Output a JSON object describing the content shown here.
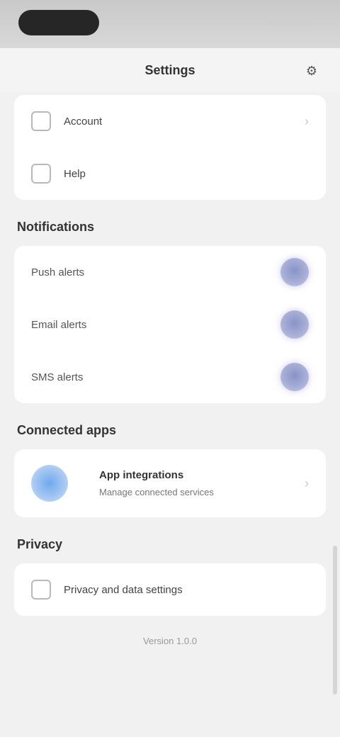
{
  "header": {
    "title": "Settings",
    "action_icon": "settings-icon"
  },
  "account": {
    "items": [
      {
        "label": "Account",
        "icon": "account-icon"
      },
      {
        "label": "Help",
        "icon": "help-icon"
      }
    ]
  },
  "notifications": {
    "title": "Notifications",
    "items": [
      {
        "label": "Push alerts",
        "icon": "toggle-on"
      },
      {
        "label": "Email alerts",
        "icon": "toggle-on"
      },
      {
        "label": "SMS alerts",
        "icon": "toggle-on"
      }
    ]
  },
  "apps": {
    "title": "Connected apps",
    "items": [
      {
        "name": "App integrations",
        "desc": "Manage connected services",
        "logo": "app-logo"
      }
    ]
  },
  "privacy": {
    "title": "Privacy",
    "items": [
      {
        "label": "Privacy and data settings",
        "icon": "lock-icon"
      }
    ]
  },
  "footer": {
    "text": "Version 1.0.0"
  },
  "colors": {
    "toggle_accent": "#8a93c8",
    "app_logo": "#6fa9ef",
    "background": "#f1f1f1",
    "card": "#ffffff"
  }
}
